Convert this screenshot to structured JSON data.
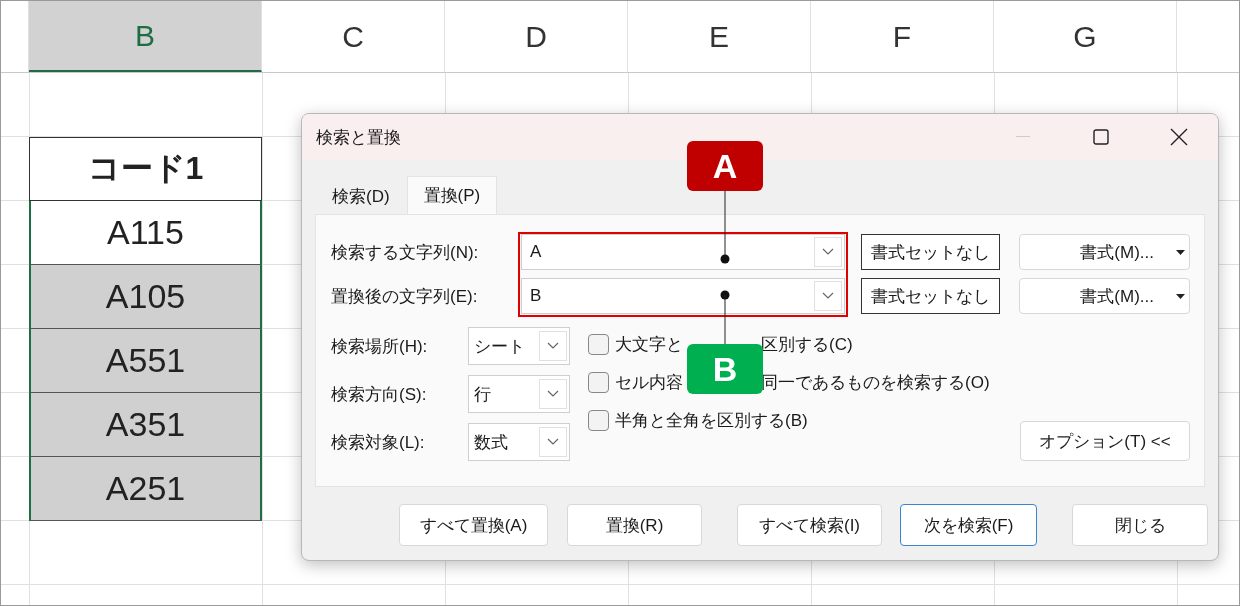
{
  "sheet": {
    "columns": [
      {
        "label": "B",
        "selected": true
      },
      {
        "label": "C",
        "selected": false
      },
      {
        "label": "D",
        "selected": false
      },
      {
        "label": "E",
        "selected": false
      },
      {
        "label": "F",
        "selected": false
      },
      {
        "label": "G",
        "selected": false
      }
    ],
    "header_cell": "コード1",
    "cells": [
      {
        "value": "A115",
        "selected": false
      },
      {
        "value": "A105",
        "selected": true
      },
      {
        "value": "A551",
        "selected": true
      },
      {
        "value": "A351",
        "selected": true
      },
      {
        "value": "A251",
        "selected": true
      }
    ]
  },
  "dialog": {
    "title": "検索と置換",
    "tabs": [
      {
        "label": "検索(D)",
        "selected": false
      },
      {
        "label": "置換(P)",
        "selected": true
      }
    ],
    "fields": [
      {
        "label": "検索する文字列(N):",
        "value": "A",
        "clear_format": "書式セットなし",
        "format": "書式(M)..."
      },
      {
        "label": "置換後の文字列(E):",
        "value": "B",
        "clear_format": "書式セットなし",
        "format": "書式(M)..."
      }
    ],
    "selects": [
      {
        "label": "検索場所(H):",
        "value": "シート"
      },
      {
        "label": "検索方向(S):",
        "value": "行"
      },
      {
        "label": "検索対象(L):",
        "value": "数式"
      }
    ],
    "checkboxes": [
      {
        "parts": [
          "大文字と",
          "区別する(C)"
        ],
        "checked": false
      },
      {
        "parts": [
          "セル内容",
          "同一であるものを検索する(O)"
        ],
        "checked": false
      },
      {
        "parts": [
          "半角と全角を区別する(B)"
        ],
        "checked": false
      }
    ],
    "options_button": "オプション(T) <<",
    "buttons": [
      {
        "label": "すべて置換(A)",
        "default": false
      },
      {
        "label": "置換(R)",
        "default": false
      },
      {
        "label": "すべて検索(I)",
        "default": false
      },
      {
        "label": "次を検索(F)",
        "default": true
      },
      {
        "label": "閉じる",
        "default": false
      }
    ]
  },
  "annotations": [
    {
      "label": "A",
      "color": "#c00000"
    },
    {
      "label": "B",
      "color": "#00b050"
    }
  ]
}
